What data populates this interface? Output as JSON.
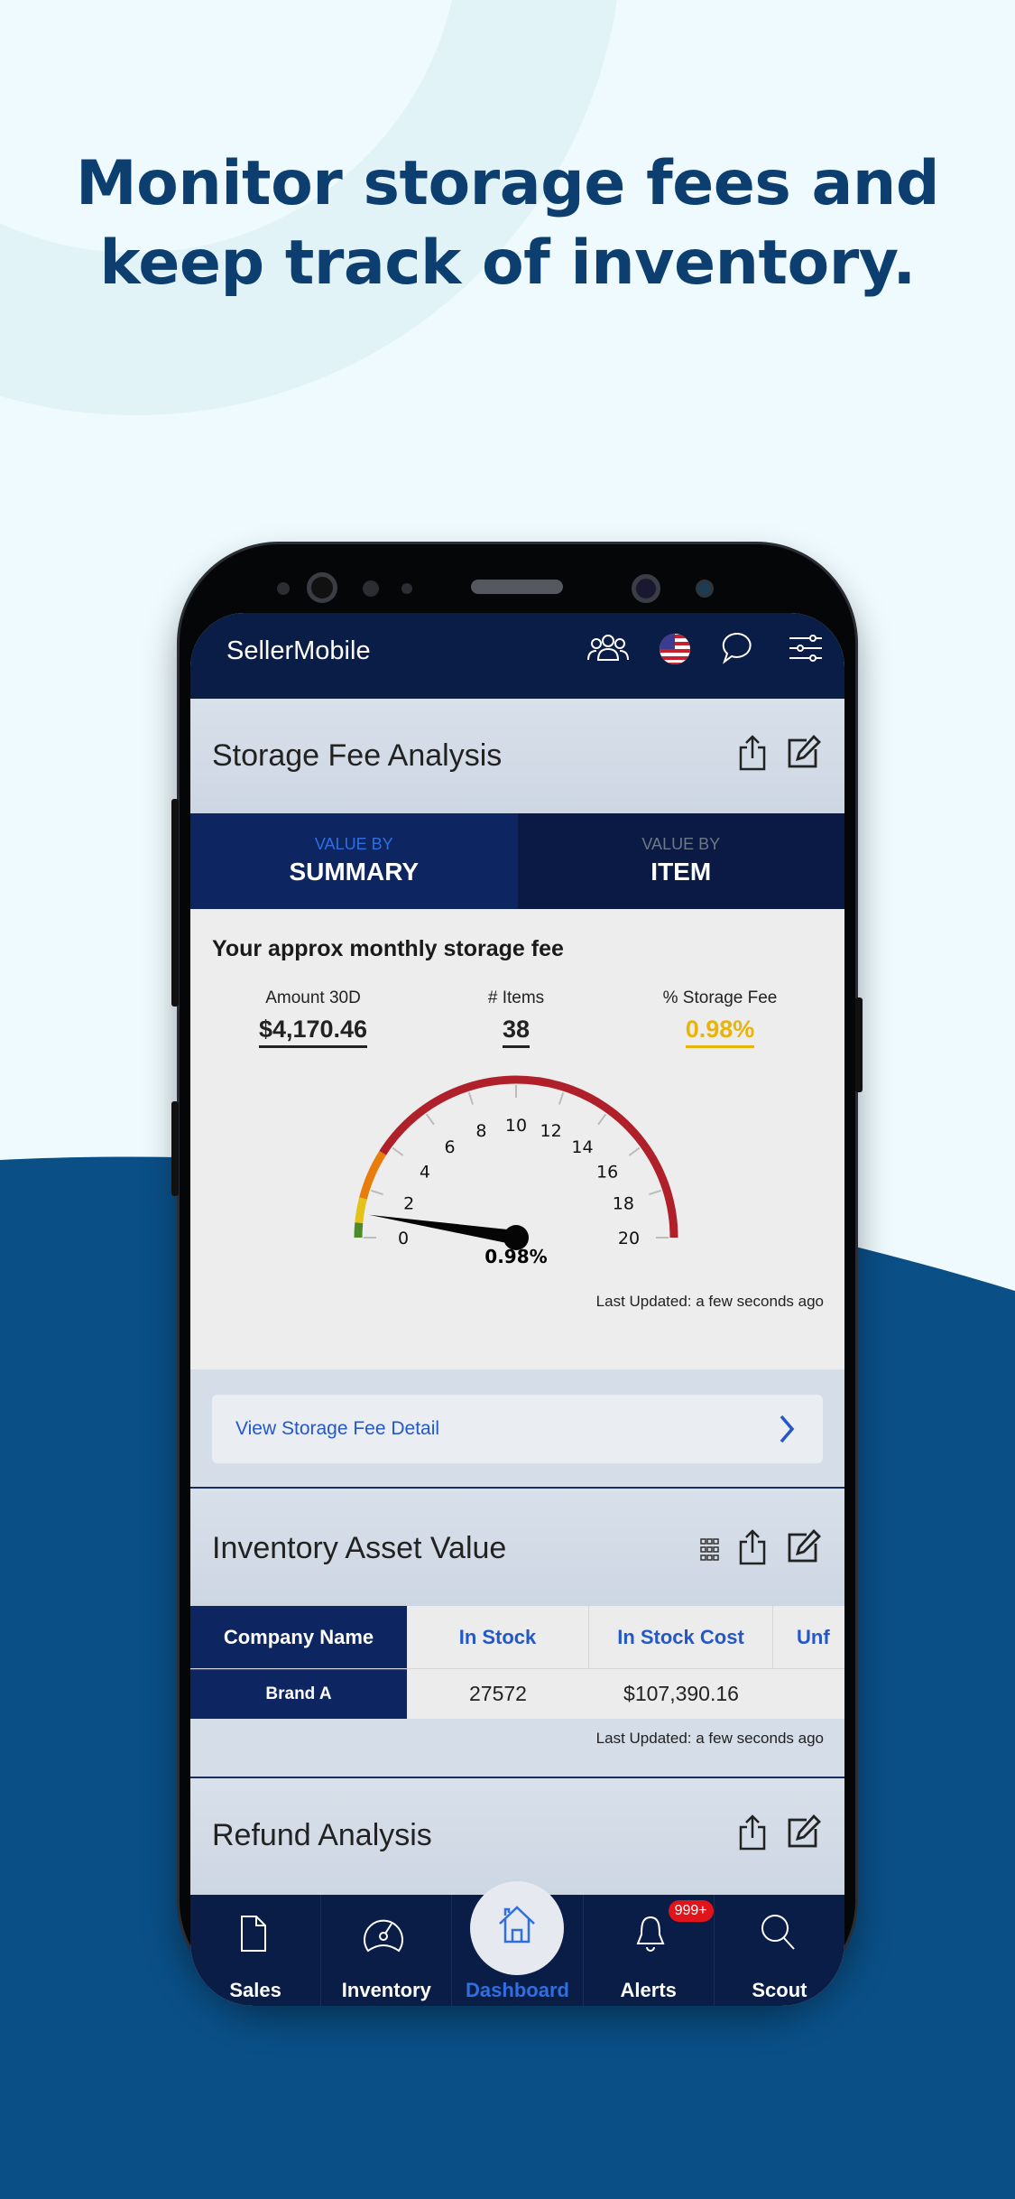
{
  "headline": [
    "Monitor storage fees and",
    "keep track of inventory."
  ],
  "colors": {
    "brand_navy": "#0a1d47",
    "accent_blue": "#2458c7",
    "fee_yellow": "#e8b40c",
    "headline": "#0c3f70",
    "wave": "#0a4f86"
  },
  "app": {
    "title": "SellerMobile",
    "header_icons": [
      "users-icon",
      "us-flag-icon",
      "chat-icon",
      "filter-sliders-icon"
    ]
  },
  "storage_fee": {
    "title": "Storage Fee Analysis",
    "tabs": [
      {
        "sub": "VALUE BY",
        "main": "SUMMARY",
        "active": true
      },
      {
        "sub": "VALUE BY",
        "main": "ITEM",
        "active": false
      }
    ],
    "heading": "Your approx monthly storage fee",
    "metrics": [
      {
        "label": "Amount 30D",
        "value": "$4,170.46"
      },
      {
        "label": "# Items",
        "value": "38"
      },
      {
        "label": "% Storage Fee",
        "value": "0.98%"
      }
    ],
    "gauge": {
      "min": 0,
      "max": 20,
      "value": 0.98,
      "ticks": [
        "0",
        "2",
        "4",
        "6",
        "8",
        "10",
        "12",
        "14",
        "16",
        "18",
        "20"
      ],
      "bands": [
        {
          "from": 0,
          "to": 0.6,
          "color": "#4b8b2a"
        },
        {
          "from": 0.6,
          "to": 1.6,
          "color": "#e4c21a"
        },
        {
          "from": 1.6,
          "to": 3.6,
          "color": "#e87d0e"
        },
        {
          "from": 3.6,
          "to": 20,
          "color": "#b0202a"
        }
      ],
      "value_label": "0.98%"
    },
    "last_updated": "Last Updated: a few seconds ago",
    "detail_link": "View Storage Fee Detail"
  },
  "inventory": {
    "title": "Inventory Asset Value",
    "columns": [
      "Company Name",
      "In Stock",
      "In Stock Cost",
      "Unf"
    ],
    "rows": [
      [
        "Brand A",
        "27572",
        "$107,390.16",
        ""
      ]
    ],
    "last_updated": "Last Updated: a few seconds ago"
  },
  "refund": {
    "title": "Refund Analysis"
  },
  "tabbar": {
    "items": [
      {
        "label": "Sales",
        "icon": "document-icon"
      },
      {
        "label": "Inventory",
        "icon": "speedometer-icon"
      },
      {
        "label": "Dashboard",
        "icon": "home-icon",
        "active": true
      },
      {
        "label": "Alerts",
        "icon": "bell-icon",
        "badge": "999+"
      },
      {
        "label": "Scout",
        "icon": "search-icon"
      }
    ]
  }
}
